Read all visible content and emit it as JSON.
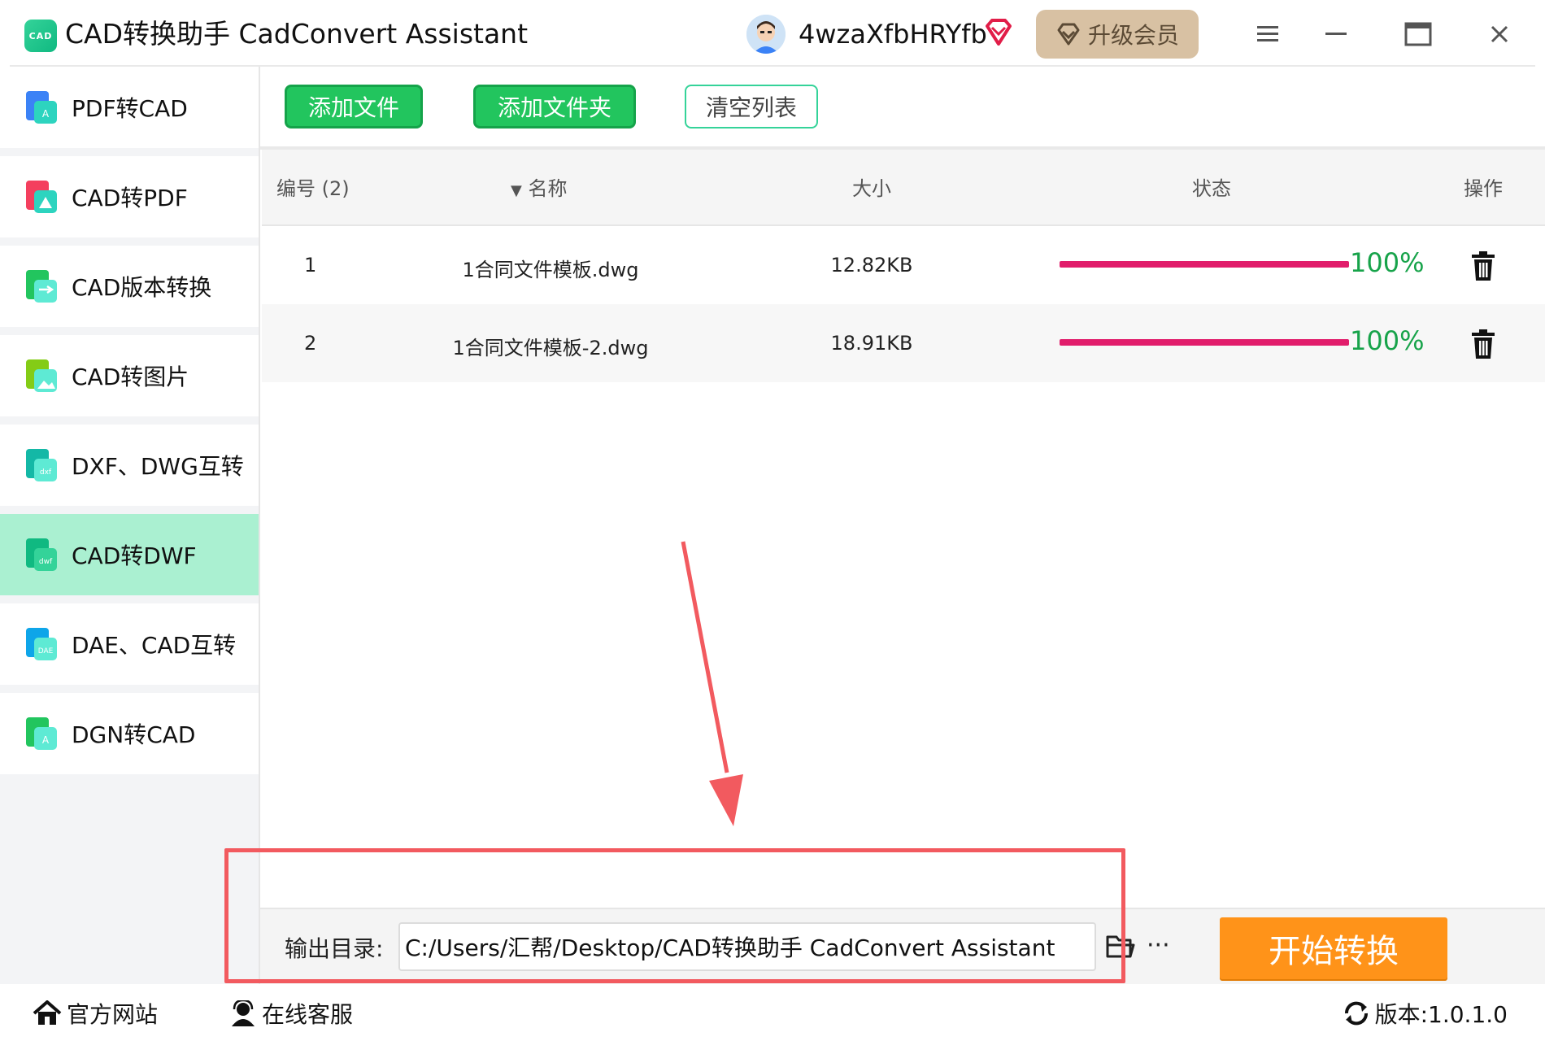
{
  "window": {
    "app_logo_text": "CAD",
    "title": "CAD转换助手 CadConvert Assistant",
    "username": "4wzaXfbHRYfb",
    "upgrade_label": "升级会员"
  },
  "sidebar": {
    "items": [
      {
        "label": "PDF转CAD",
        "icon": "pdf-to-cad-icon",
        "active": false
      },
      {
        "label": "CAD转PDF",
        "icon": "cad-to-pdf-icon",
        "active": false
      },
      {
        "label": "CAD版本转换",
        "icon": "cad-version-icon",
        "active": false
      },
      {
        "label": "CAD转图片",
        "icon": "cad-to-image-icon",
        "active": false
      },
      {
        "label": "DXF、DWG互转",
        "icon": "dxf-dwg-icon",
        "active": false
      },
      {
        "label": "CAD转DWF",
        "icon": "cad-to-dwf-icon",
        "active": true
      },
      {
        "label": "DAE、CAD互转",
        "icon": "dae-cad-icon",
        "active": false
      },
      {
        "label": "DGN转CAD",
        "icon": "dgn-to-cad-icon",
        "active": false
      }
    ]
  },
  "toolbar": {
    "add_file": "添加文件",
    "add_folder": "添加文件夹",
    "clear_list": "清空列表"
  },
  "table": {
    "headers": {
      "number": "编号 (2)",
      "name": "名称",
      "size": "大小",
      "status": "状态",
      "action": "操作"
    },
    "rows": [
      {
        "num": "1",
        "name": "1合同文件模板.dwg",
        "size": "12.82KB",
        "progress": 100,
        "progress_label": "100%"
      },
      {
        "num": "2",
        "name": "1合同文件模板-2.dwg",
        "size": "18.91KB",
        "progress": 100,
        "progress_label": "100%"
      }
    ]
  },
  "output": {
    "label": "输出目录:",
    "path": "C:/Users/汇帮/Desktop/CAD转换助手 CadConvert Assistant",
    "more": "···",
    "start_label": "开始转换"
  },
  "footer": {
    "website": "官方网站",
    "support": "在线客服",
    "version": "版本:1.0.1.0"
  },
  "colors": {
    "accent_green": "#22c55e",
    "active_sidebar": "#aaf0d1",
    "progress": "#e11d6b",
    "percent_text": "#17a34a",
    "start_button": "#ff9319",
    "annotation_red": "#f25a5f"
  }
}
